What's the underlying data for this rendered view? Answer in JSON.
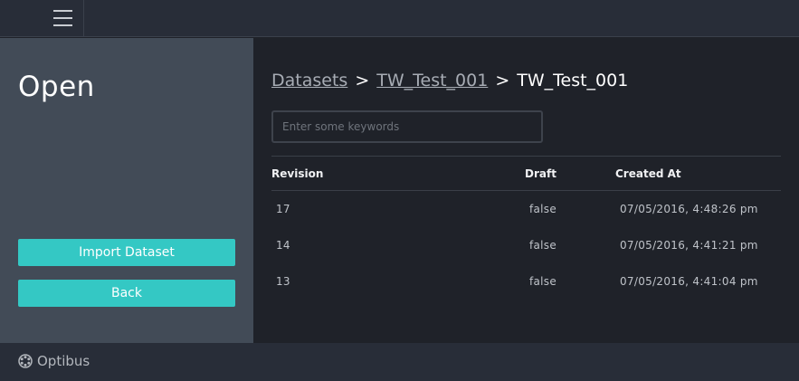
{
  "topbar": {
    "menu_icon": "hamburger-menu-icon"
  },
  "sidebar": {
    "title": "Open",
    "buttons": {
      "import_label": "Import Dataset",
      "back_label": "Back"
    }
  },
  "breadcrumb": {
    "root": "Datasets",
    "parent": "TW_Test_001",
    "current": "TW_Test_001",
    "separator": ">"
  },
  "search": {
    "placeholder": "Enter some keywords",
    "value": ""
  },
  "table": {
    "headers": {
      "revision": "Revision",
      "draft": "Draft",
      "created_at": "Created At"
    },
    "rows": [
      {
        "revision": "17",
        "draft": "false",
        "created_at": "07/05/2016, 4:48:26 pm"
      },
      {
        "revision": "14",
        "draft": "false",
        "created_at": "07/05/2016, 4:41:21 pm"
      },
      {
        "revision": "13",
        "draft": "false",
        "created_at": "07/05/2016, 4:41:04 pm"
      }
    ]
  },
  "footer": {
    "brand": "Optibus",
    "brand_icon": "optibus-logo-icon"
  },
  "colors": {
    "accent": "#34c8c4",
    "sidebar_bg": "#424b57",
    "main_bg": "#1f2229",
    "bar_bg": "#282d38"
  }
}
